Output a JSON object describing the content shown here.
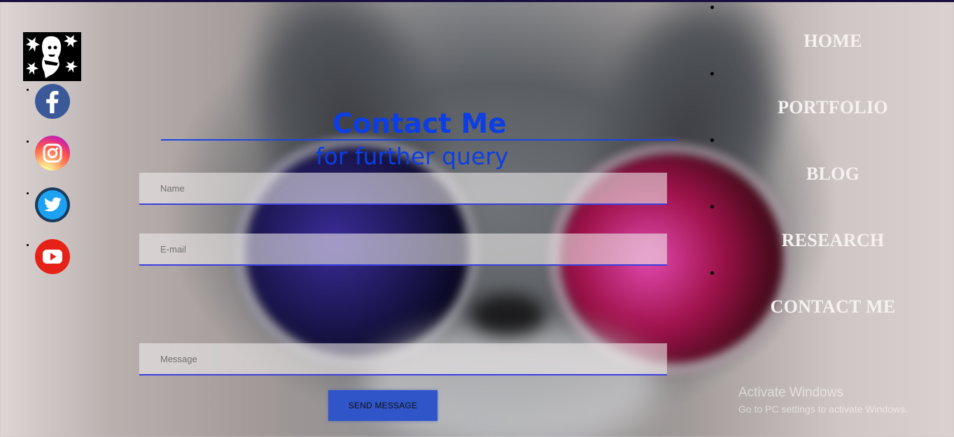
{
  "social": {
    "items": [
      {
        "name": "facebook",
        "icon": "facebook-icon",
        "color": "#3b5998"
      },
      {
        "name": "instagram",
        "icon": "instagram-icon",
        "color": "#d6249f"
      },
      {
        "name": "twitter",
        "icon": "twitter-icon",
        "color": "#1da1f2"
      },
      {
        "name": "youtube",
        "icon": "youtube-icon",
        "color": "#e62117"
      }
    ]
  },
  "contact": {
    "title": "Contact Me",
    "subtitle": "for further query",
    "name_placeholder": "Name",
    "email_placeholder": "E-mail",
    "message_placeholder": "Message",
    "send_label": "SEND MESSAGE",
    "accent_color": "#0c3ee6"
  },
  "nav": {
    "items": [
      {
        "label": "HOME"
      },
      {
        "label": "PORTFOLIO"
      },
      {
        "label": "BLOG"
      },
      {
        "label": "RESEARCH"
      },
      {
        "label": "CONTACT ME"
      }
    ]
  },
  "watermark": {
    "title": "Activate Windows",
    "subtitle": "Go to PC settings to activate Windows."
  }
}
